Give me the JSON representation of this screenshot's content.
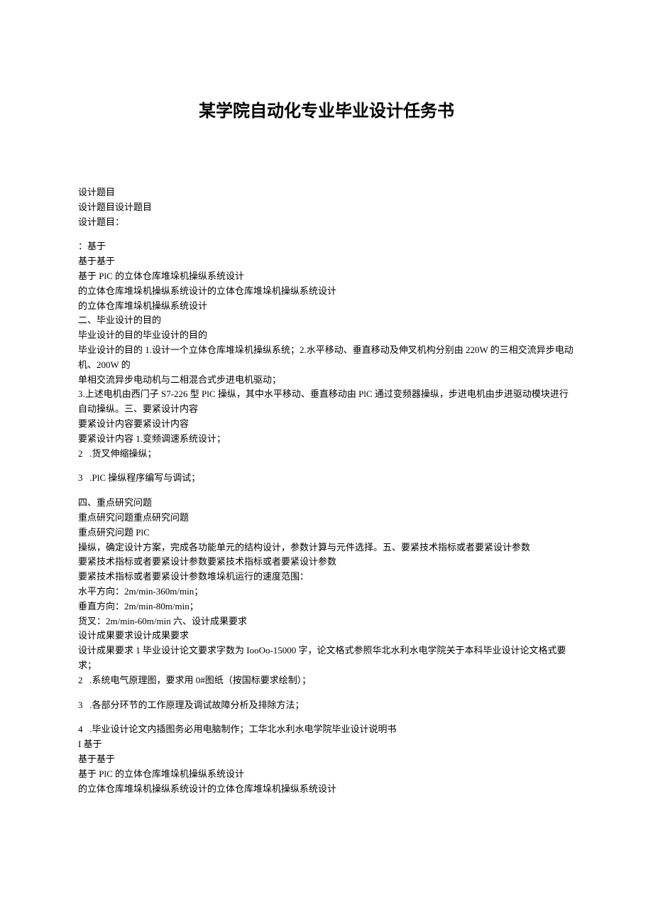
{
  "title": "某学院自动化专业毕业设计任务书",
  "lines": [
    "设计题目",
    "设计题目设计题目",
    "设计题目：",
    "",
    "：基于",
    "基于基于",
    "基于 PlC 的立体仓库堆垛机操纵系统设计",
    "的立体仓库堆垛机操纵系统设计的立体仓库堆垛机操纵系统设计",
    "的立体仓库堆垛机操纵系统设计",
    "二、毕业设计的目的",
    "毕业设计的目的毕业设计的目的",
    "毕业设计的目的 1.设计一个立体仓库堆垛机操纵系统；2.水平移动、垂直移动及伸叉机构分别由 220W 的三相交流异步电动机、200W 的",
    "单相交流异步电动机与二相混合式步进电机驱动；",
    "3.上述电机由西门子 S7-226 型 PlC 操纵，其中水平移动、垂直移动由 PlC 通过变频器操纵，步进电机由步进驱动模块进行自动操纵。三、要紧设计内容",
    "要紧设计内容要紧设计内容",
    "要紧设计内容 1.变频调速系统设计；",
    "2   .货叉伸缩操纵；",
    "",
    "3   .PlC 操纵程序编写与调试；",
    "",
    "四、重点研究问题",
    "重点研究问题重点研究问题",
    "重点研究问题 PlC",
    "操纵，确定设计方案，完成各功能单元的结构设计，参数计算与元件选择。五、要紧技术指标或者要紧设计参数",
    "要紧技术指标或者要紧设计参数要紧技术指标或者要紧设计参数",
    "要紧技术指标或者要紧设计参数堆垛机运行的速度范围：",
    "水平方向：2m/min-360m/min；",
    "垂直方向：2m/min-80m/min；",
    "货叉：2m/min-60m/min 六、设计成果要求",
    "设计成果要求设计成果要求",
    "设计成果要求 1 毕业设计论文要求字数为 IooOo-15000 字，论文格式参照华北水利水电学院关于本科毕业设计论文格式要求；",
    "2   .系统电气原理图，要求用 0#图纸（按国标要求绘制）；",
    "",
    "3   .各部分环节的工作原理及调试故障分析及排除方法；",
    "",
    "4   .毕业设计论文内插图务必用电脑制作；工华北水利水电学院毕业设计说明书",
    "I 基于",
    "基于基于",
    "基于 PlC 的立体仓库堆垛机操纵系统设计",
    "的立体仓库堆垛机操纵系统设计的立体仓库堆垛机操纵系统设计"
  ]
}
